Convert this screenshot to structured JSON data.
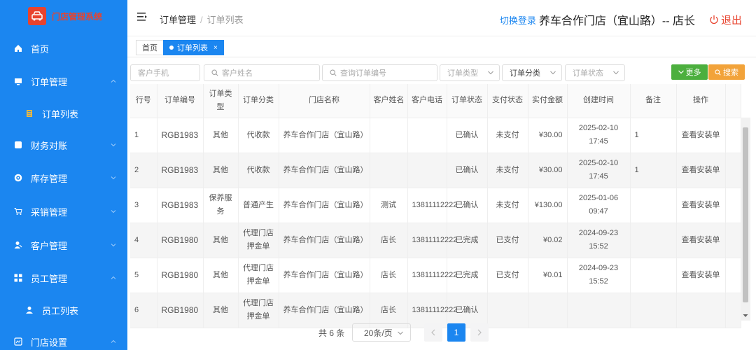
{
  "app": {
    "logo_text": "门店管理系统"
  },
  "sidebar": {
    "items": [
      {
        "label": "首页"
      },
      {
        "label": "订单管理"
      },
      {
        "label": "订单列表"
      },
      {
        "label": "财务对账"
      },
      {
        "label": "库存管理"
      },
      {
        "label": "采销管理"
      },
      {
        "label": "客户管理"
      },
      {
        "label": "员工管理"
      },
      {
        "label": "员工列表"
      },
      {
        "label": "门店设置"
      }
    ]
  },
  "header": {
    "breadcrumb": [
      "订单管理",
      "订单列表"
    ],
    "switch_login": "切换登录",
    "store": "养车合作门店（宜山路）-- 店长",
    "logout": "退出"
  },
  "tabs": [
    {
      "label": "首页"
    },
    {
      "label": "订单列表",
      "close": "×"
    }
  ],
  "filters": {
    "customer_phone": "客户手机",
    "customer_name": "客户姓名",
    "order_no": "查询订单编号",
    "order_type": "订单类型",
    "order_category": "订单分类",
    "order_status": "订单状态",
    "more_button": "更多",
    "search_button": "搜索"
  },
  "table": {
    "headers": [
      "行号",
      "订单编号",
      "订单类型",
      "订单分类",
      "门店名称",
      "客户姓名",
      "客户电话",
      "订单状态",
      "支付状态",
      "实付金额",
      "创建时间",
      "备注",
      "操作"
    ],
    "rows": [
      [
        "1",
        "RGB1983",
        "其他",
        "代收款",
        "养车合作门店（宜山路）",
        "",
        "",
        "已确认",
        "未支付",
        "¥30.00",
        "2025-02-10 17:45",
        "1",
        "查看安装单"
      ],
      [
        "2",
        "RGB1983",
        "其他",
        "代收款",
        "养车合作门店（宜山路）",
        "",
        "",
        "已确认",
        "未支付",
        "¥30.00",
        "2025-02-10 17:45",
        "1",
        "查看安装单"
      ],
      [
        "3",
        "RGB1983",
        "保养服务",
        "普通产生",
        "养车合作门店（宜山路）",
        "测试",
        "13811112222",
        "已确认",
        "未支付",
        "¥130.00",
        "2025-01-06 09:47",
        "",
        "查看安装单"
      ],
      [
        "4",
        "RGB1980",
        "其他",
        "代理门店押金单",
        "养车合作门店（宜山路）",
        "店长",
        "13811112222",
        "已完成",
        "已支付",
        "¥0.02",
        "2024-09-23 15:52",
        "",
        "查看安装单"
      ],
      [
        "5",
        "RGB1980",
        "其他",
        "代理门店押金单",
        "养车合作门店（宜山路）",
        "店长",
        "13811112222",
        "已完成",
        "已支付",
        "¥0.01",
        "2024-09-23 15:52",
        "",
        "查看安装单"
      ],
      [
        "6",
        "RGB1980",
        "其他",
        "代理门店押金单",
        "养车合作门店（宜山路）",
        "店长",
        "13811112222",
        "已确认",
        "",
        "",
        "",
        "",
        ""
      ]
    ]
  },
  "pagination": {
    "total": "共 6 条",
    "page_size": "20条/页",
    "current_page": "1"
  }
}
